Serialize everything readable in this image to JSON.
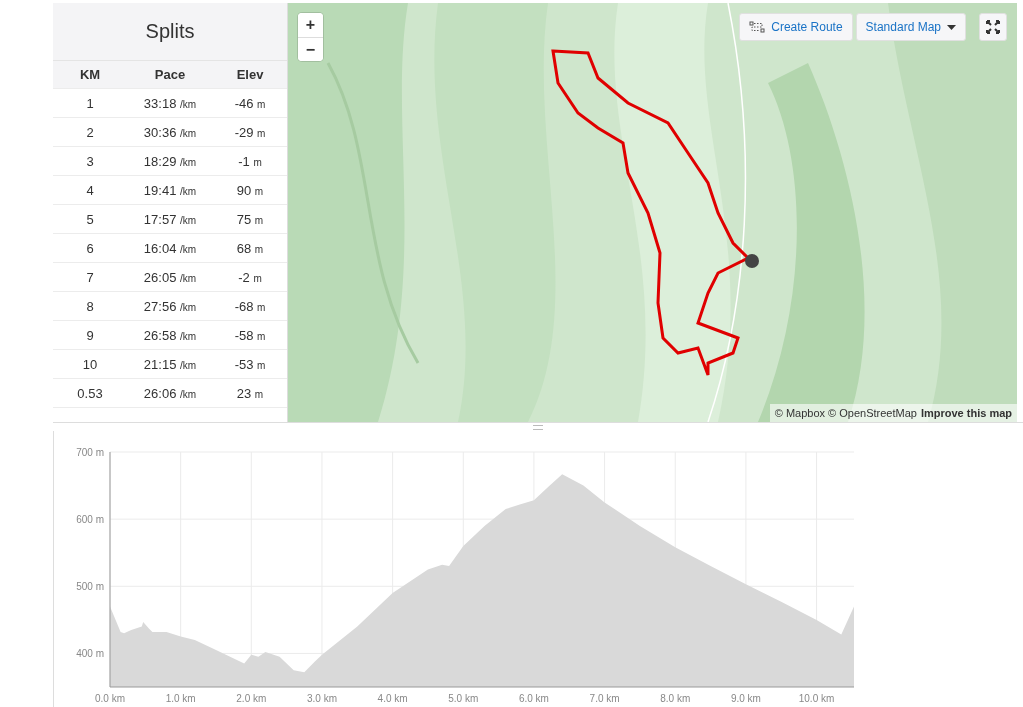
{
  "splits": {
    "title": "Splits",
    "columns": [
      "KM",
      "Pace",
      "Elev"
    ],
    "rows": [
      {
        "km": "1",
        "pace": "33:18",
        "pace_unit": "/km",
        "elev": "-46",
        "elev_unit": "m"
      },
      {
        "km": "2",
        "pace": "30:36",
        "pace_unit": "/km",
        "elev": "-29",
        "elev_unit": "m"
      },
      {
        "km": "3",
        "pace": "18:29",
        "pace_unit": "/km",
        "elev": "-1",
        "elev_unit": "m"
      },
      {
        "km": "4",
        "pace": "19:41",
        "pace_unit": "/km",
        "elev": "90",
        "elev_unit": "m"
      },
      {
        "km": "5",
        "pace": "17:57",
        "pace_unit": "/km",
        "elev": "75",
        "elev_unit": "m"
      },
      {
        "km": "6",
        "pace": "16:04",
        "pace_unit": "/km",
        "elev": "68",
        "elev_unit": "m"
      },
      {
        "km": "7",
        "pace": "26:05",
        "pace_unit": "/km",
        "elev": "-2",
        "elev_unit": "m"
      },
      {
        "km": "8",
        "pace": "27:56",
        "pace_unit": "/km",
        "elev": "-68",
        "elev_unit": "m"
      },
      {
        "km": "9",
        "pace": "26:58",
        "pace_unit": "/km",
        "elev": "-58",
        "elev_unit": "m"
      },
      {
        "km": "10",
        "pace": "21:15",
        "pace_unit": "/km",
        "elev": "-53",
        "elev_unit": "m"
      },
      {
        "km": "0.53",
        "pace": "26:06",
        "pace_unit": "/km",
        "elev": "23",
        "elev_unit": "m"
      }
    ]
  },
  "map": {
    "kind": "picture",
    "zoom_in": "+",
    "zoom_out": "−",
    "create_route": "Create Route",
    "map_style": "Standard Map",
    "attribution": "© Mapbox © OpenStreetMap",
    "improve_link": "Improve this map"
  },
  "elevation": {
    "chart_data": {
      "type": "area",
      "ylim": [
        350,
        700
      ],
      "xlim": [
        0,
        10.53
      ],
      "yticks": [
        {
          "value": 400,
          "label": "400 m"
        },
        {
          "value": 500,
          "label": "500 m"
        },
        {
          "value": 600,
          "label": "600 m"
        },
        {
          "value": 700,
          "label": "700 m"
        }
      ],
      "xticks": [
        {
          "value": 0,
          "label": "0.0 km"
        },
        {
          "value": 1,
          "label": "1.0 km"
        },
        {
          "value": 2,
          "label": "2.0 km"
        },
        {
          "value": 3,
          "label": "3.0 km"
        },
        {
          "value": 4,
          "label": "4.0 km"
        },
        {
          "value": 5,
          "label": "5.0 km"
        },
        {
          "value": 6,
          "label": "6.0 km"
        },
        {
          "value": 7,
          "label": "7.0 km"
        },
        {
          "value": 8,
          "label": "8.0 km"
        },
        {
          "value": 9,
          "label": "9.0 km"
        },
        {
          "value": 10,
          "label": "10.0 km"
        }
      ],
      "x": [
        0,
        0.15,
        0.2,
        0.3,
        0.45,
        0.47,
        0.55,
        0.6,
        0.8,
        1.0,
        1.2,
        1.5,
        1.9,
        2.0,
        2.1,
        2.2,
        2.4,
        2.6,
        2.75,
        2.9,
        3.0,
        3.5,
        4.0,
        4.5,
        4.7,
        4.8,
        5.0,
        5.3,
        5.6,
        5.8,
        6.0,
        6.2,
        6.4,
        6.7,
        7.0,
        7.5,
        8.0,
        8.5,
        9.0,
        9.5,
        10.0,
        10.35,
        10.53
      ],
      "grid": true,
      "series": [
        {
          "color": "#d9d9d9",
          "values": [
            470,
            432,
            430,
            435,
            440,
            447,
            437,
            432,
            432,
            425,
            420,
            405,
            385,
            398,
            395,
            402,
            395,
            375,
            372,
            388,
            398,
            440,
            490,
            525,
            532,
            530,
            560,
            590,
            615,
            622,
            628,
            648,
            667,
            650,
            625,
            590,
            558,
            530,
            503,
            477,
            450,
            428,
            470
          ]
        }
      ]
    }
  }
}
